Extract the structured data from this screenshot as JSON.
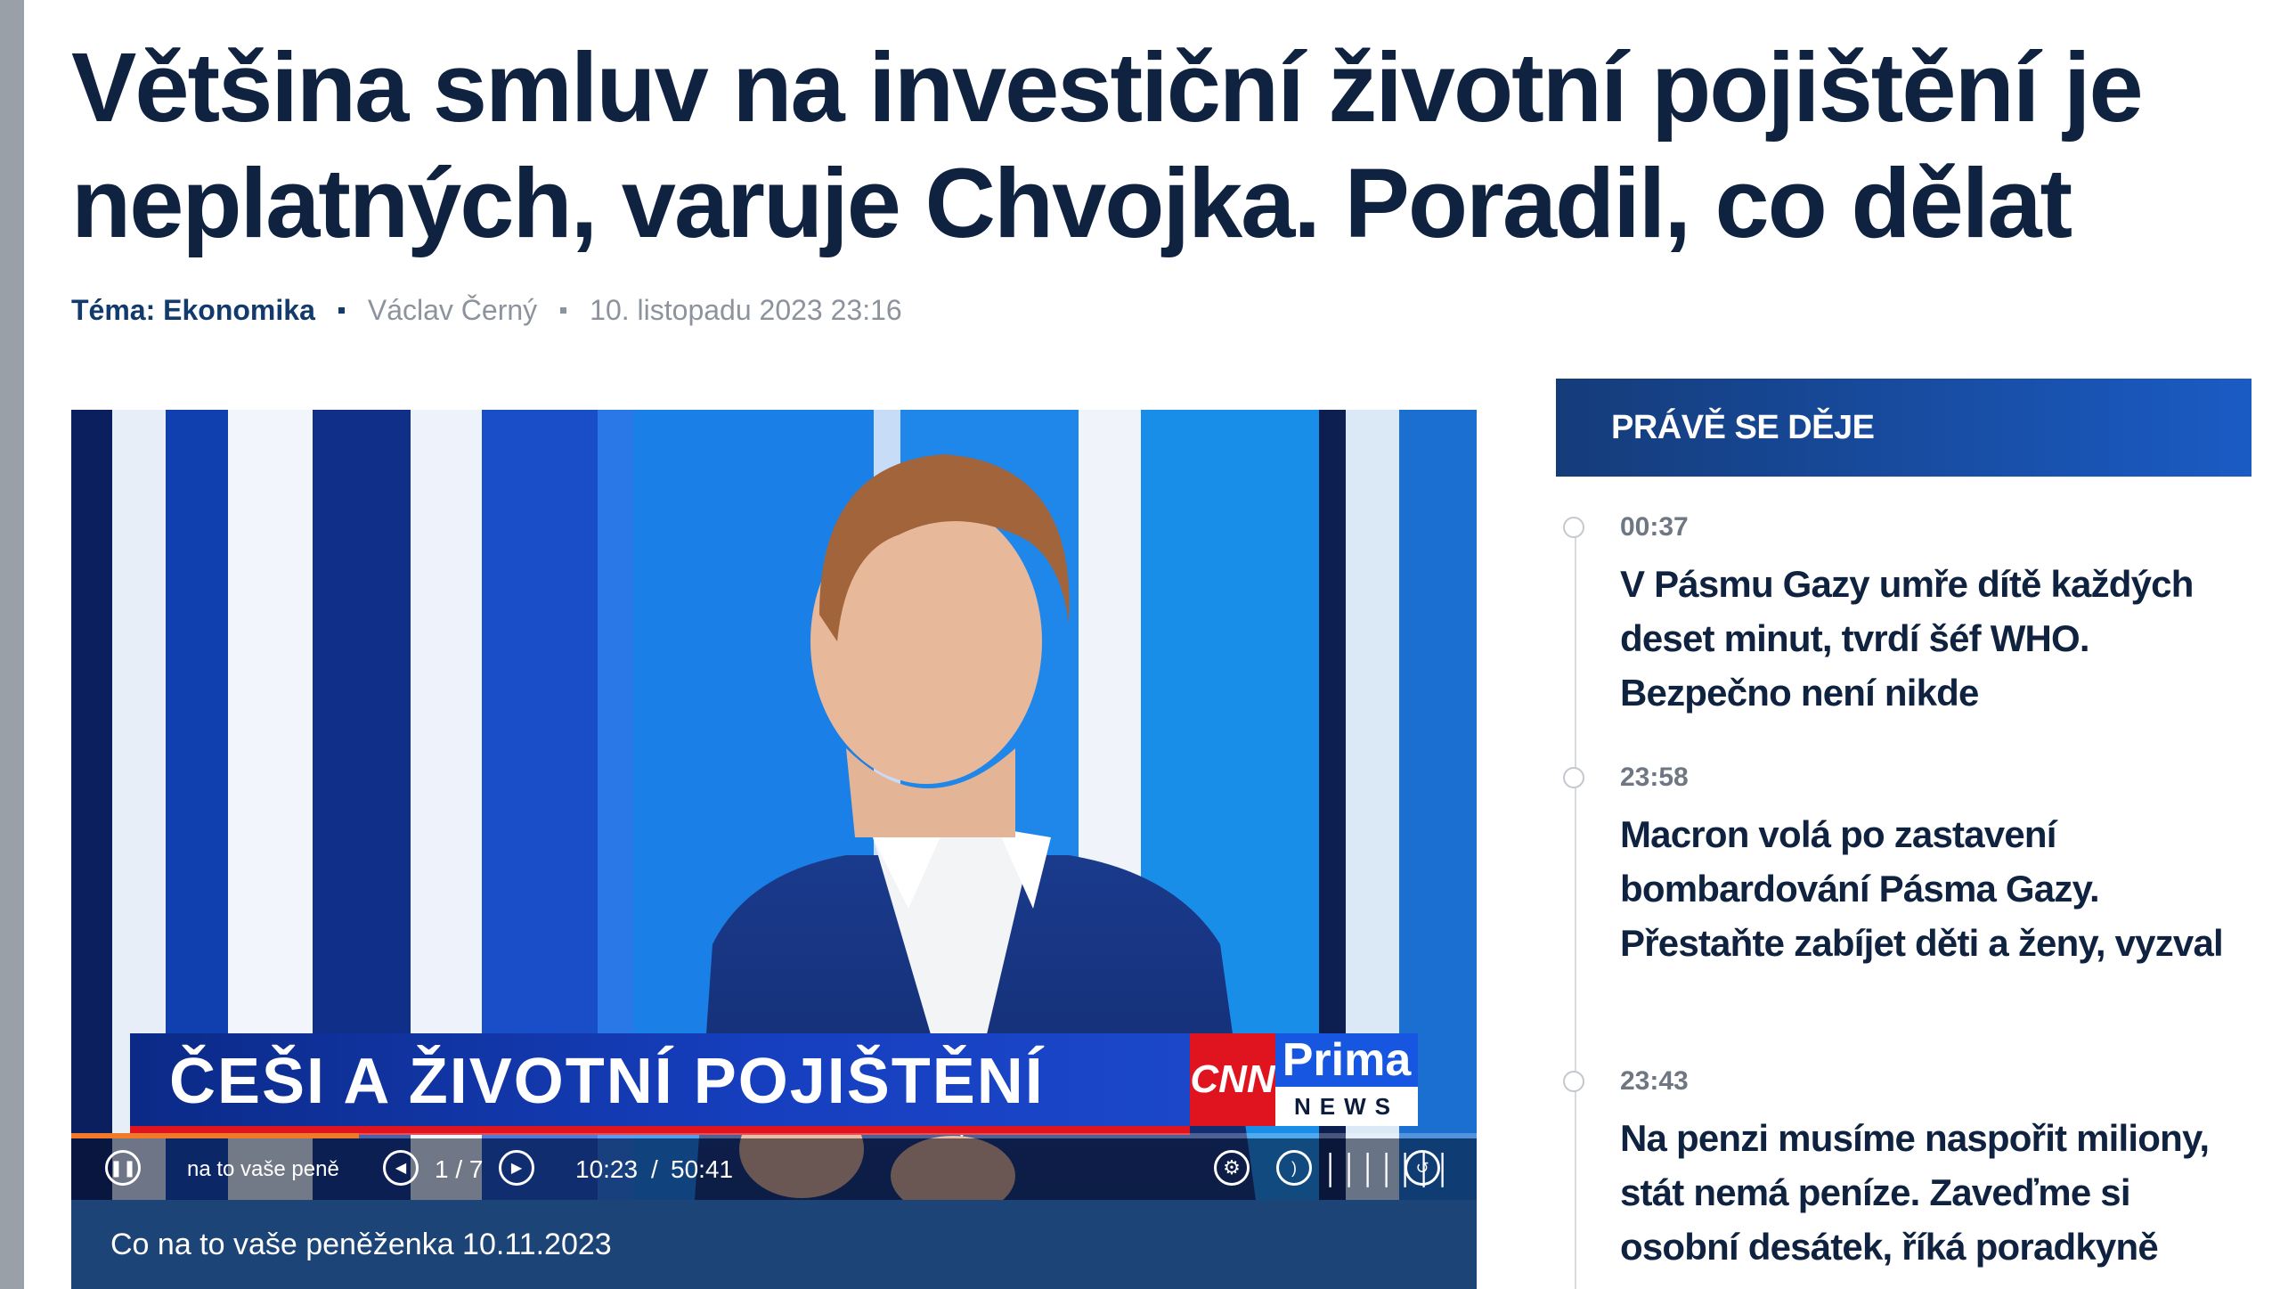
{
  "article": {
    "headline": "Většina smluv na investiční životní pojištění je neplatných, varuje Chvojka. Poradil, co dělat",
    "topic": "Téma: Ekonomika",
    "author": "Václav Černý",
    "date": "10. listopadu 2023 23:16"
  },
  "video": {
    "lower_third": "ČEŠI A ŽIVOTNÍ POJIŠTĚNÍ",
    "logo_cnn": "CNN",
    "logo_prima": "Prima",
    "logo_news": "NEWS",
    "chapter_label": "na to vaše peněženka",
    "chapter_counter": "1 / 7",
    "time_current": "10:23",
    "time_separator": "/",
    "time_total": "50:41",
    "progress": 0.205,
    "caption": "Co na to vaše peněženka 10.11.2023"
  },
  "sidebar": {
    "header": "PRÁVĚ SE DĚJE",
    "items": [
      {
        "time": "00:37",
        "title": "V Pásmu Gazy umře dítě každých deset minut, tvrdí šéf WHO. Bezpečno není nikde"
      },
      {
        "time": "23:58",
        "title": "Macron volá po zastavení bombardování Pásma Gazy. Přestaňte zabíjet děti a ženy, vyzval"
      },
      {
        "time": "23:43",
        "title": "Na penzi musíme naspořit miliony, stát nemá peníze. Zaveďme si osobní desátek, říká poradkyně"
      }
    ]
  },
  "colors": {
    "headline": "#0f2240",
    "topic": "#133a6c",
    "meta": "#8c939c",
    "sidebar_header": "#1a5bc4",
    "caption_bar": "#1d4477",
    "progress": "#f07a2a",
    "brand_red": "#e0141e"
  },
  "icons": [
    "pause-icon",
    "previous-chapter-icon",
    "next-chapter-icon",
    "settings-icon",
    "volume-icon",
    "fullscreen-icon"
  ]
}
